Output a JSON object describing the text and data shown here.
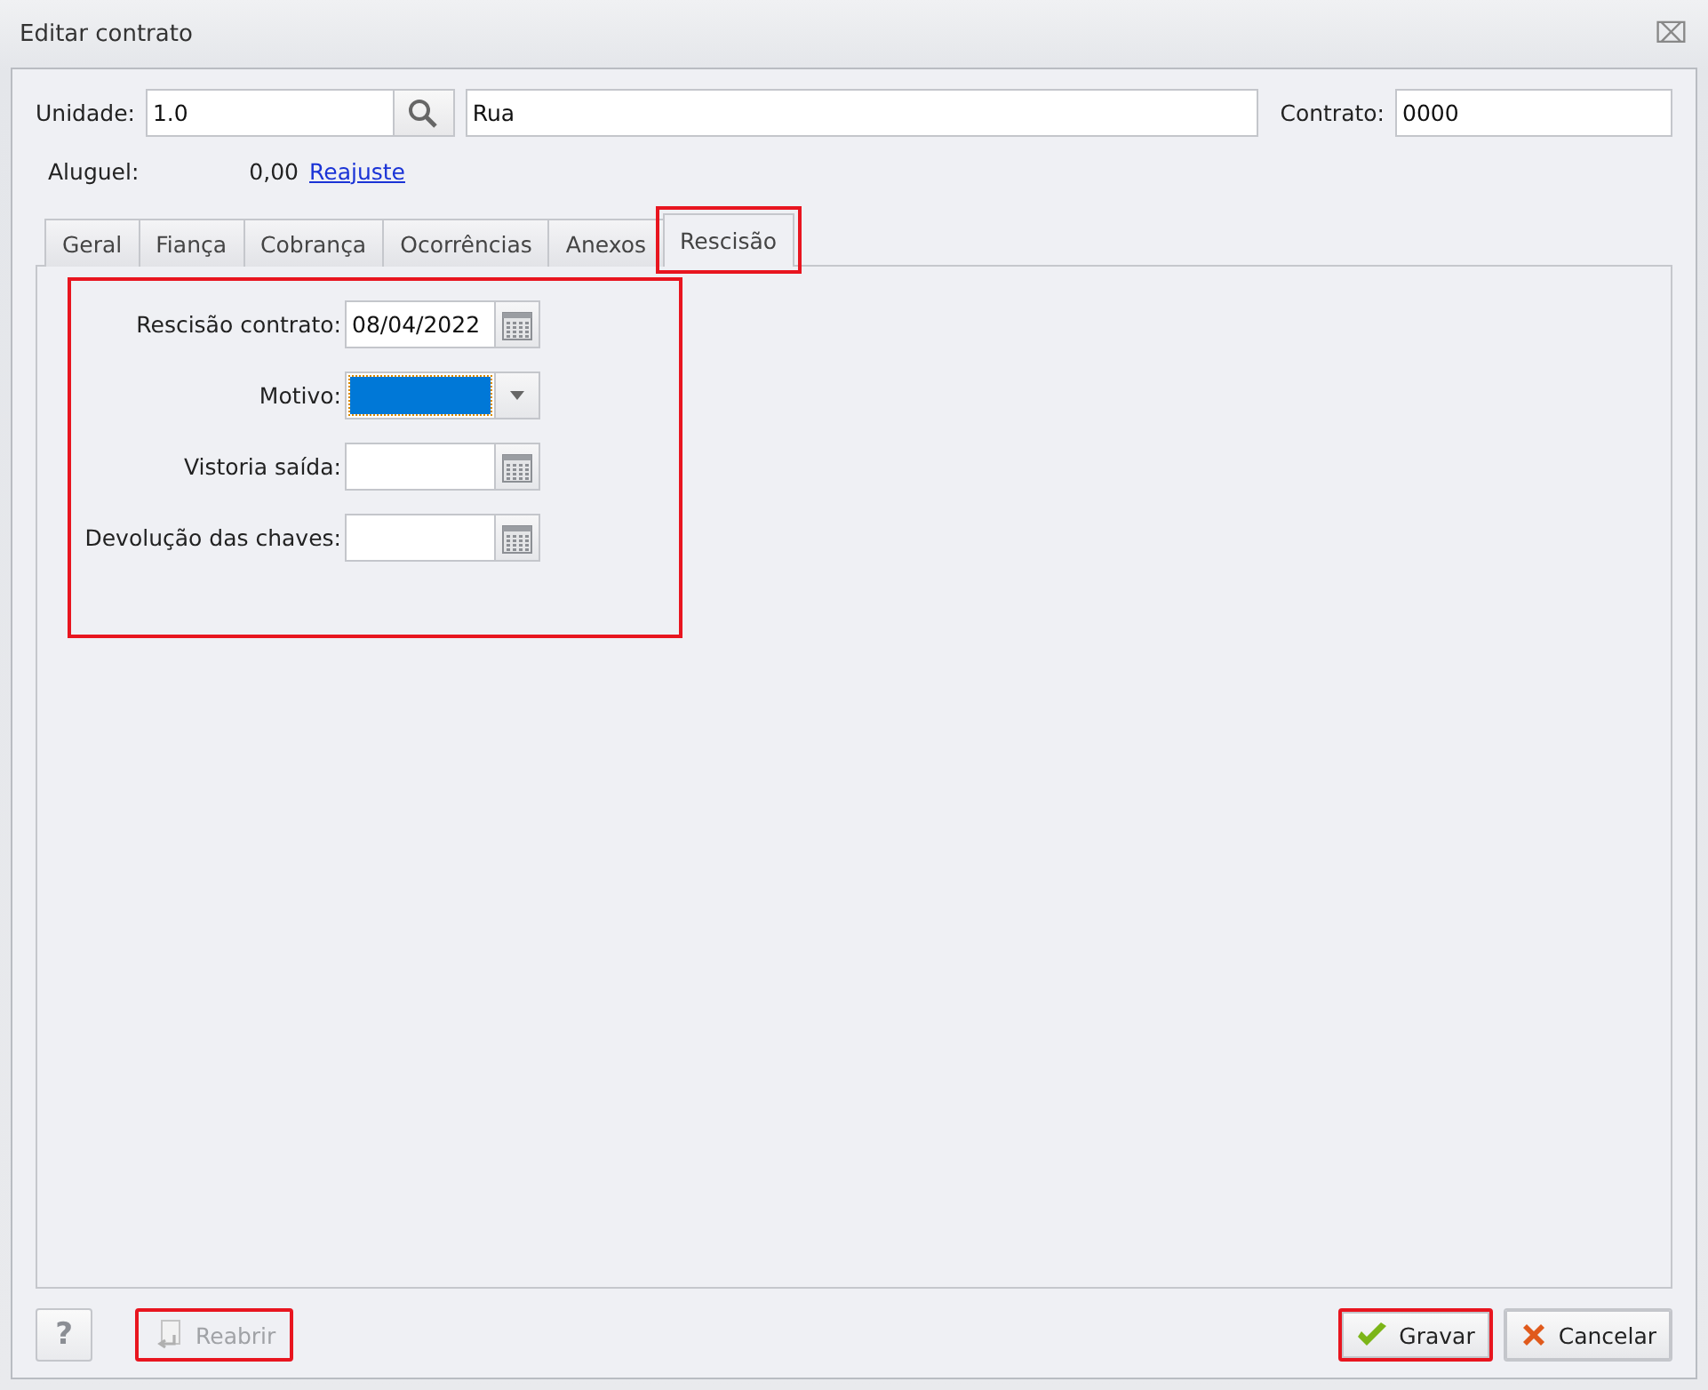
{
  "window": {
    "title": "Editar contrato",
    "close": "⌧"
  },
  "header": {
    "unit_label": "Unidade:",
    "unit_value": "1.0",
    "street_value": "Rua",
    "contract_label": "Contrato:",
    "contract_value": "0000",
    "rent_label": "Aluguel:",
    "rent_value": "0,00",
    "adjust_link": "Reajuste"
  },
  "tabs": [
    {
      "label": "Geral",
      "selected": false,
      "highlighted": false
    },
    {
      "label": "Fiança",
      "selected": false,
      "highlighted": false
    },
    {
      "label": "Cobrança",
      "selected": false,
      "highlighted": false
    },
    {
      "label": "Ocorrências",
      "selected": false,
      "highlighted": false
    },
    {
      "label": "Anexos",
      "selected": false,
      "highlighted": false
    },
    {
      "label": "Rescisão",
      "selected": true,
      "highlighted": true
    }
  ],
  "form": {
    "highlighted": true,
    "fields": [
      {
        "kind": "date",
        "label": "Rescisão contrato:",
        "value": "08/04/2022"
      },
      {
        "kind": "select",
        "label": "Motivo:",
        "focused": true
      },
      {
        "kind": "date",
        "label": "Vistoria saída:"
      },
      {
        "kind": "date",
        "label": "Devolução das chaves:"
      }
    ]
  },
  "footer": {
    "help": "?",
    "buttons": [
      {
        "kind": "reopen",
        "label": "Reabrir",
        "disabled": true,
        "highlighted": true
      },
      {
        "kind": "save",
        "label": "Gravar",
        "disabled": false,
        "highlighted": true
      },
      {
        "kind": "cancel",
        "label": "Cancelar",
        "disabled": false,
        "highlighted": false
      }
    ]
  }
}
